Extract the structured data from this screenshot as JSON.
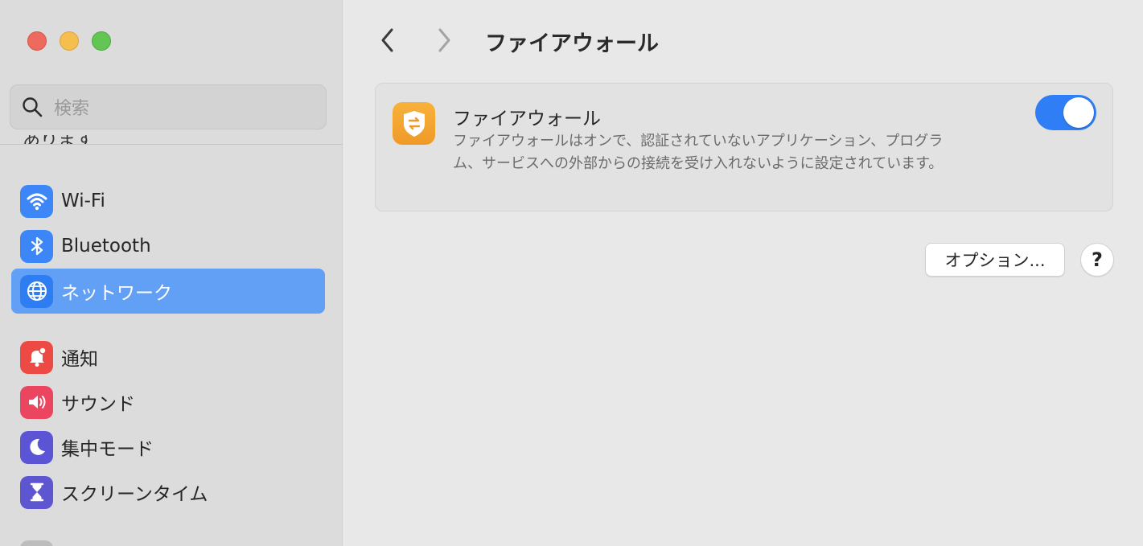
{
  "window": {
    "controls": [
      "close",
      "minimize",
      "maximize"
    ]
  },
  "sidebar": {
    "search_placeholder": "検索",
    "cut_item_label": "あります",
    "items": [
      {
        "label": "Wi-Fi",
        "icon": "wifi-icon",
        "color": "#3c86f7"
      },
      {
        "label": "Bluetooth",
        "icon": "bluetooth-icon",
        "color": "#3c86f7"
      },
      {
        "label": "ネットワーク",
        "icon": "globe-icon",
        "color": "#2f7df3",
        "selected": true
      },
      {
        "label": "通知",
        "icon": "bell-icon",
        "color": "#ee4a45"
      },
      {
        "label": "サウンド",
        "icon": "speaker-icon",
        "color": "#ec4560"
      },
      {
        "label": "集中モード",
        "icon": "moon-icon",
        "color": "#5b55d6"
      },
      {
        "label": "スクリーンタイム",
        "icon": "hourglass-icon",
        "color": "#5e55d0"
      }
    ]
  },
  "main": {
    "title": "ファイアウォール",
    "firewall": {
      "title": "ファイアウォール",
      "description": "ファイアウォールはオンで、認証されていないアプリケーション、プログラム、サービスへの外部からの接続を受け入れないように設定されています。",
      "enabled": true,
      "accent_color": "#2f7ef5",
      "icon": "firewall-shield-icon"
    },
    "options_label": "オプション...",
    "help_label": "?"
  }
}
